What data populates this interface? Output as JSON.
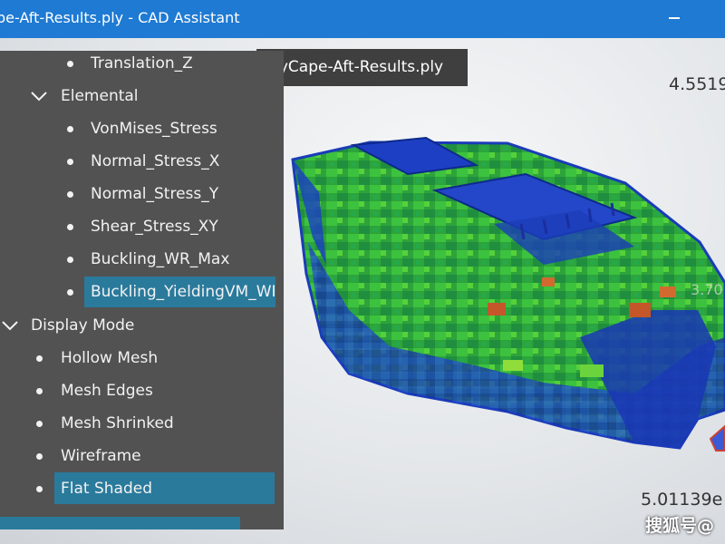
{
  "window": {
    "title": "pe-Aft-Results.ply - CAD Assistant"
  },
  "viewport": {
    "file_tab": "BabyCape-Aft-Results.ply",
    "scale_max": "4.5519",
    "scale_min": "5.01139e",
    "side_label": "3.70",
    "watermark": "搜狐号@"
  },
  "tree": {
    "partial_item": "Translation_Z",
    "group_elemental": "Elemental",
    "elemental_items": [
      "VonMises_Stress",
      "Normal_Stress_X",
      "Normal_Stress_Y",
      "Shear_Stress_XY",
      "Buckling_WR_Max",
      "Buckling_YieldingVM_WR"
    ],
    "group_display": "Display Mode",
    "display_items": [
      "Hollow Mesh",
      "Mesh Edges",
      "Mesh Shrinked",
      "Wireframe",
      "Flat Shaded"
    ]
  },
  "colors": {
    "titlebar": "#1e7ad3",
    "panel": "#525252",
    "selection": "#2a7a9c"
  }
}
